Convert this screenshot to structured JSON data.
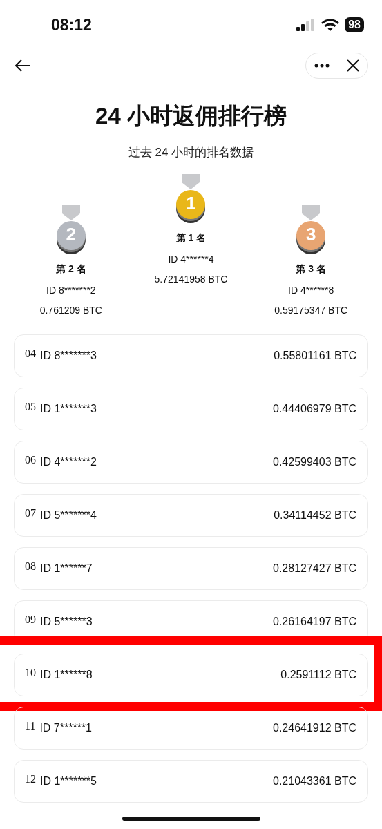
{
  "status_bar": {
    "time": "08:12",
    "battery": "98"
  },
  "title": "24 小时返佣排行榜",
  "subtitle": "过去 24 小时的排名数据",
  "podium": [
    {
      "medal": "2",
      "color": "#b4b8bf",
      "rank_label": "第 2 名",
      "id": "ID 8*******2",
      "amount": "0.761209 BTC",
      "raised": false
    },
    {
      "medal": "1",
      "color": "#e9b719",
      "rank_label": "第 1 名",
      "id": "ID 4******4",
      "amount": "5.72141958 BTC",
      "raised": true
    },
    {
      "medal": "3",
      "color": "#e8a572",
      "rank_label": "第 3 名",
      "id": "ID 4******8",
      "amount": "0.59175347 BTC",
      "raised": false
    }
  ],
  "rows": [
    {
      "rank": "04",
      "id": "ID 8*******3",
      "amount": "0.55801161 BTC",
      "highlighted": false
    },
    {
      "rank": "05",
      "id": "ID 1*******3",
      "amount": "0.44406979 BTC",
      "highlighted": false
    },
    {
      "rank": "06",
      "id": "ID 4*******2",
      "amount": "0.42599403 BTC",
      "highlighted": false
    },
    {
      "rank": "07",
      "id": "ID 5*******4",
      "amount": "0.34114452 BTC",
      "highlighted": false
    },
    {
      "rank": "08",
      "id": "ID 1******7",
      "amount": "0.28127427 BTC",
      "highlighted": false
    },
    {
      "rank": "09",
      "id": "ID 5******3",
      "amount": "0.26164197 BTC",
      "highlighted": false
    },
    {
      "rank": "10",
      "id": "ID 1******8",
      "amount": "0.2591112 BTC",
      "highlighted": true
    },
    {
      "rank": "11",
      "id": "ID 7******1",
      "amount": "0.24641912 BTC",
      "highlighted": false
    },
    {
      "rank": "12",
      "id": "ID 1*******5",
      "amount": "0.21043361 BTC",
      "highlighted": false
    }
  ]
}
